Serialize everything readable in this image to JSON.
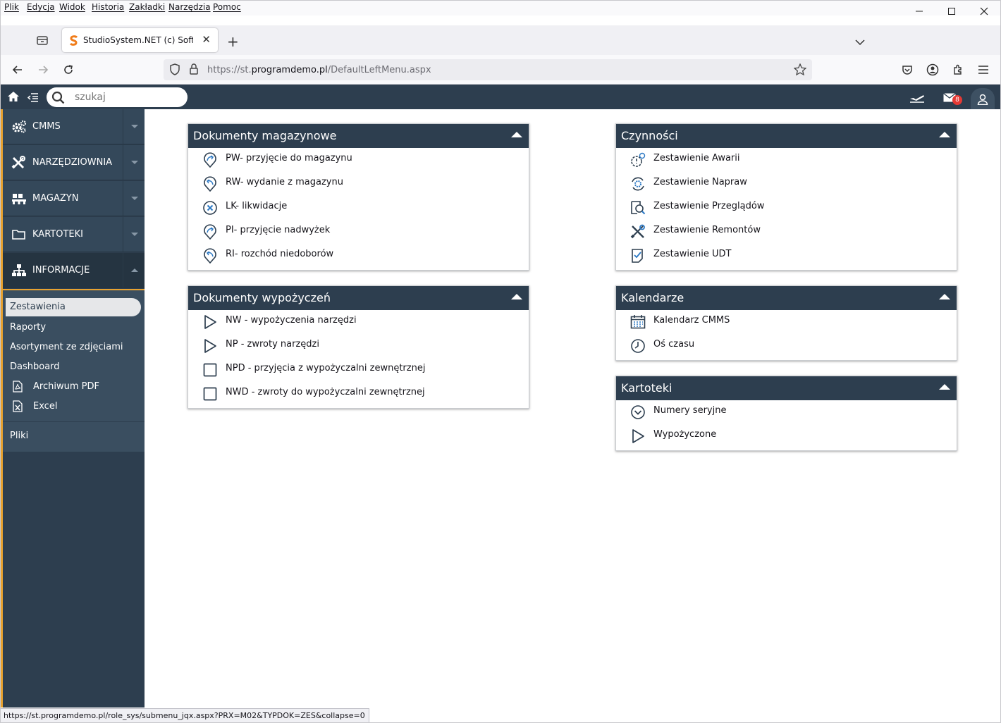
{
  "browser": {
    "menu": [
      "Plik",
      "Edycja",
      "Widok",
      "Historia",
      "Zakładki",
      "Narzędzia",
      "Pomoc"
    ],
    "tab_title": "StudioSystem.NET (c) Software Studio",
    "url_prefix": "https://st.",
    "url_domain": "programdemo.pl",
    "url_path": "/DefaultLeftMenu.aspx",
    "status_url": "https://st.programdemo.pl/role_sys/submenu_jqx.aspx?PRX=M02&TYPDOK=ZES&collapse=0"
  },
  "header": {
    "search_placeholder": "szukaj",
    "mail_count": "8"
  },
  "sidebar": {
    "items": [
      {
        "label": "CMMS",
        "icon": "gears-icon"
      },
      {
        "label": "NARZĘDZIOWNIA",
        "icon": "tools-icon"
      },
      {
        "label": "MAGAZYN",
        "icon": "pallet-icon"
      },
      {
        "label": "KARTOTEKI",
        "icon": "folder-icon"
      },
      {
        "label": "INFORMACJE",
        "icon": "sitemap-icon"
      }
    ],
    "sub_items": [
      "Zestawienia",
      "Raporty",
      "Asortyment ze zdjęciami",
      "Dashboard",
      "Archiwum PDF",
      "Excel",
      "Pliki"
    ]
  },
  "panels": {
    "dokumenty_magazynowe": {
      "title": "Dokumenty magazynowe",
      "rows": [
        "PW- przyjęcie do magazynu",
        "RW- wydanie z magazynu",
        "LK- likwidacje",
        "PI- przyjęcie nadwyżek",
        "RI- rozchód niedoborów"
      ]
    },
    "dokumenty_wypozyczen": {
      "title": "Dokumenty wypożyczeń",
      "rows": [
        "NW - wypożyczenia narzędzi",
        "NP - zwroty narzędzi",
        "NPD - przyjęcia z wypożyczalni zewnętrznej",
        "NWD - zwroty do wypożyczalni zewnętrznej"
      ]
    },
    "czynnosci": {
      "title": "Czynności",
      "rows": [
        "Zestawienie Awarii",
        "Zestawienie Napraw",
        "Zestawienie Przeglądów",
        "Zestawienie Remontów",
        "Zestawienie UDT"
      ]
    },
    "kalendarze": {
      "title": "Kalendarze",
      "rows": [
        "Kalendarz CMMS",
        "Oś czasu"
      ]
    },
    "kartoteki": {
      "title": "Kartoteki",
      "rows": [
        "Numery seryjne",
        "Wypożyczone"
      ]
    }
  }
}
